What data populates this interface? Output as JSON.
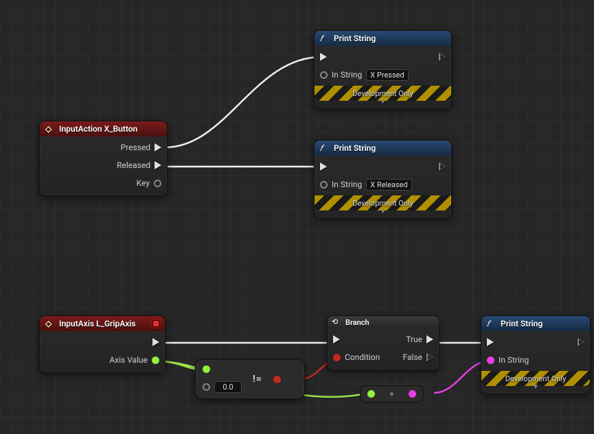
{
  "nodes": {
    "inputAction": {
      "title": "InputAction X_Button",
      "pins": {
        "pressed": "Pressed",
        "released": "Released",
        "key": "Key"
      }
    },
    "printPressed": {
      "title": "Print String",
      "inString": "In String",
      "value": "X Pressed",
      "devOnly": "Development Only"
    },
    "printReleased": {
      "title": "Print String",
      "inString": "In String",
      "value": "X Released",
      "devOnly": "Development Only"
    },
    "inputAxis": {
      "title": "InputAxis L_GripAxis",
      "axisValue": "Axis Value"
    },
    "compare": {
      "defaultB": "0.0"
    },
    "branch": {
      "title": "Branch",
      "condition": "Condition",
      "true": "True",
      "false": "False"
    },
    "printAxis": {
      "title": "Print String",
      "inString": "In String",
      "devOnly": "Development Only"
    }
  }
}
